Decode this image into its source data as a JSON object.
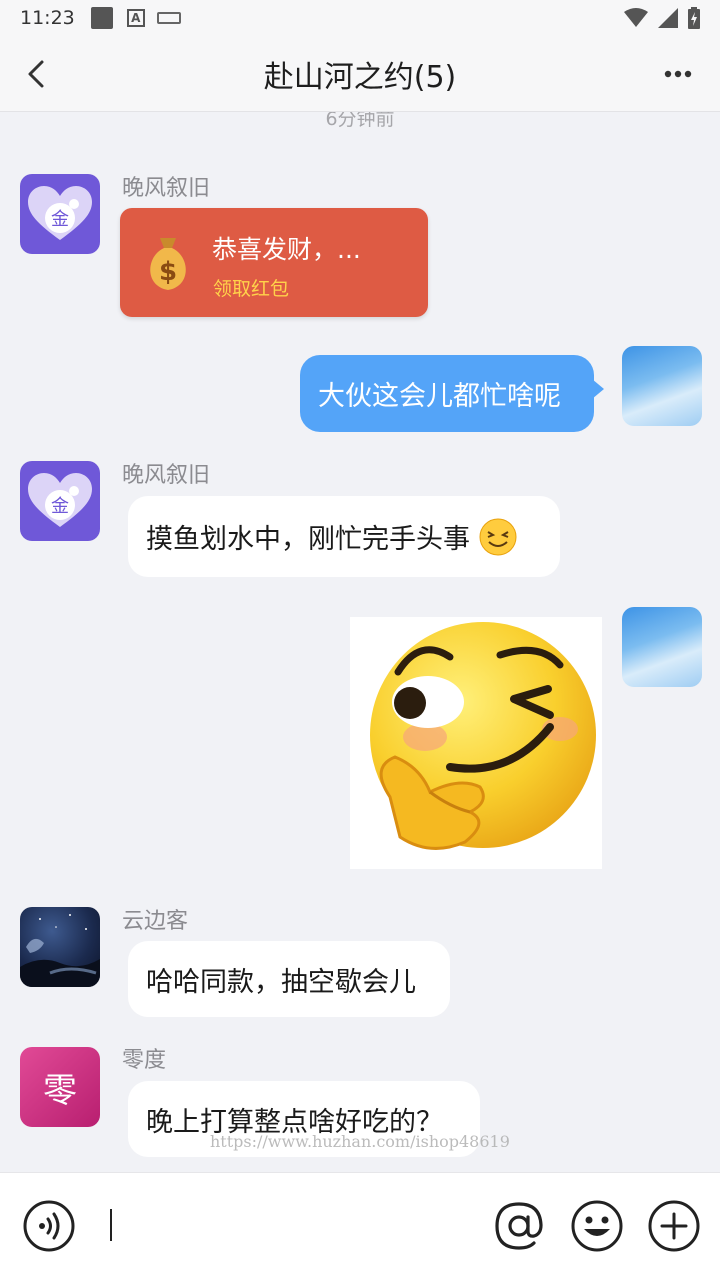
{
  "status_bar": {
    "time": "11:23"
  },
  "header": {
    "title": "赴山河之约(5)"
  },
  "chat": {
    "timestamp": "6分钟前",
    "messages": [
      {
        "sender": "晚风叙旧",
        "type": "red_packet",
        "greeting": "恭喜发财，...",
        "action": "领取红包"
      },
      {
        "sender": "me",
        "type": "text",
        "text": "大伙这会儿都忙啥呢"
      },
      {
        "sender": "晚风叙旧",
        "type": "text",
        "text": "摸鱼划水中，刚忙完手头事"
      },
      {
        "sender": "me",
        "type": "sticker",
        "icon": "wink-smirk-emoji"
      },
      {
        "sender": "云边客",
        "type": "text",
        "text": "哈哈同款，抽空歇会儿"
      },
      {
        "sender": "零度",
        "type": "text",
        "text": "晚上打算整点啥好吃的？",
        "avatar_char": "零"
      }
    ],
    "avatar_char_coin": "金",
    "watermark": "https://www.huzhan.com/ishop48619"
  },
  "input_bar": {
    "icons": [
      "voice-icon",
      "mention-icon",
      "emoji-icon",
      "plus-icon"
    ]
  },
  "colors": {
    "accent": "#54a4f8",
    "red_packet": "#de5b44",
    "purple_avatar": "#6f58d8"
  }
}
